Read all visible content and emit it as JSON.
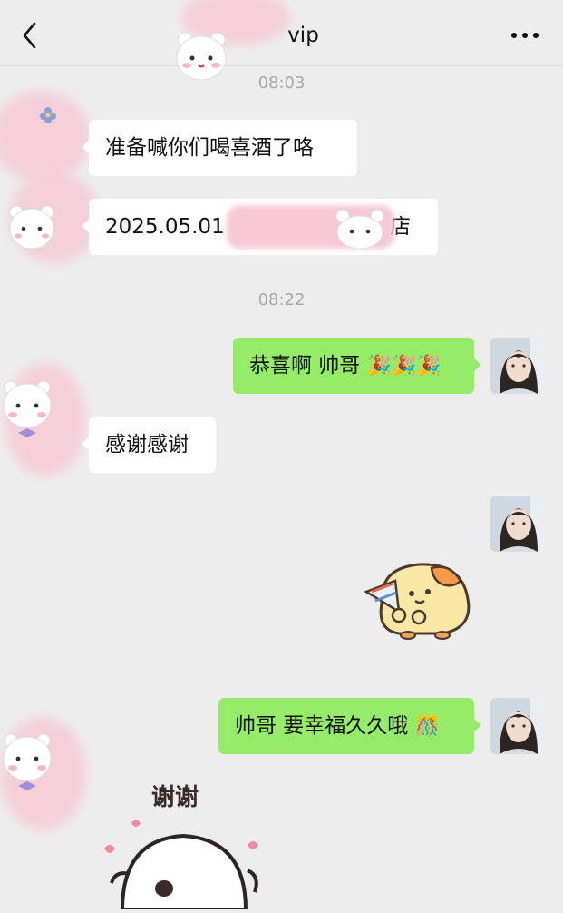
{
  "header": {
    "title": "vip",
    "back_icon": "chevron-left-icon",
    "more_icon": "more-dots-icon"
  },
  "timestamps": [
    "08:03",
    "08:22"
  ],
  "messages": [
    {
      "side": "left",
      "text": "准备喊你们喝喜酒了咯"
    },
    {
      "side": "left",
      "text_prefix": "2025.05.01",
      "text_suffix": "店"
    },
    {
      "side": "right",
      "text": "恭喜啊 帅哥",
      "emoji": "🎉🎉🎉"
    },
    {
      "side": "left",
      "text": "感谢感谢"
    },
    {
      "side": "right",
      "sticker": "hamster-popper-sticker"
    },
    {
      "side": "right",
      "text": "帅哥 要幸福久久哦",
      "emoji": "🎊"
    },
    {
      "side": "left",
      "sticker": "ghost-thanks-sticker",
      "sticker_text": "谢谢"
    }
  ],
  "colors": {
    "background": "#ededed",
    "bubble_self": "#95ec69",
    "bubble_other": "#ffffff",
    "timestamp": "#a8a8a8"
  }
}
